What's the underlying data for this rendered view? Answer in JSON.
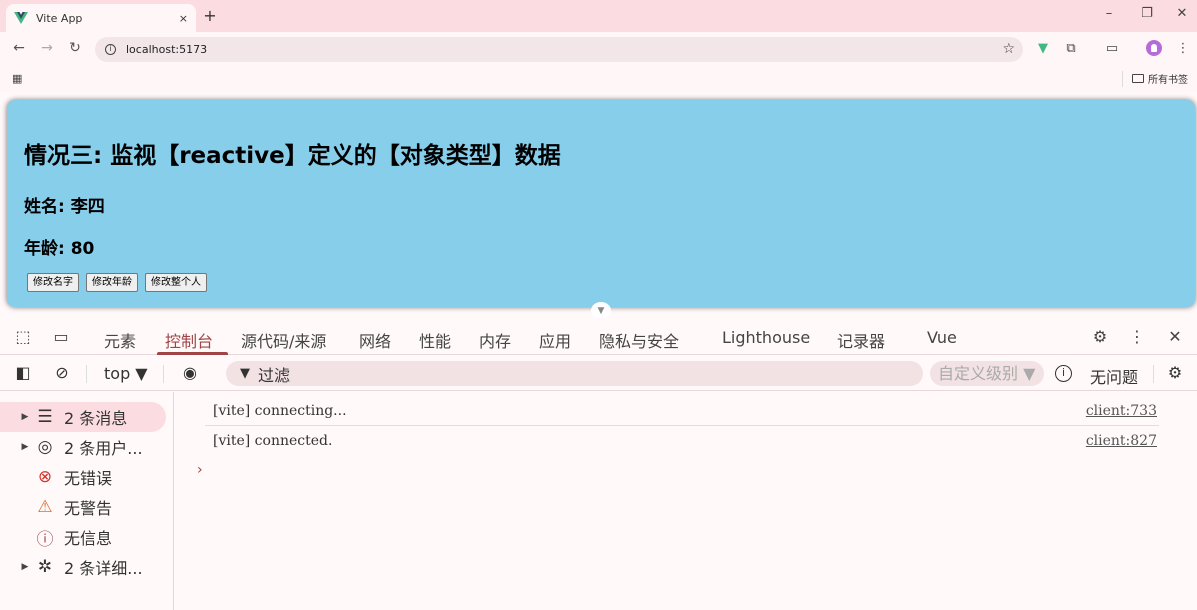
{
  "browser": {
    "tab_title": "Vite App",
    "tab_close": "×",
    "new_tab": "+",
    "address": "localhost:5173",
    "bookmarks_folder": "所有书签"
  },
  "page": {
    "heading": "情况三: 监视【reactive】定义的【对象类型】数据",
    "name_line": "姓名: 李四",
    "age_line": "年龄: 80",
    "buttons": [
      "修改名字",
      "修改年龄",
      "修改整个人"
    ]
  },
  "devtools": {
    "tabs": [
      "元素",
      "控制台",
      "源代码/来源",
      "网络",
      "性能",
      "内存",
      "应用",
      "隐私与安全",
      "Lighthouse",
      "记录器",
      "Vue"
    ],
    "active_tab": "控制台",
    "context": "top ▼",
    "filter_placeholder": "过滤",
    "levels": "自定义级别 ▼",
    "issues": "无问题",
    "sidebar": [
      {
        "label": "2 条消息",
        "icon": "list-icon"
      },
      {
        "label": "2 条用户...",
        "icon": "user-icon"
      },
      {
        "label": "无错误",
        "icon": "error-icon"
      },
      {
        "label": "无警告",
        "icon": "warning-icon"
      },
      {
        "label": "无信息",
        "icon": "info-icon"
      },
      {
        "label": "2 条详细...",
        "icon": "bug-icon"
      }
    ],
    "logs": [
      {
        "text": "[vite] connecting...",
        "source": "client:733"
      },
      {
        "text": "[vite] connected.",
        "source": "client:827"
      }
    ]
  },
  "colors": {
    "card_bg": "#87ceeb",
    "accent": "#9f4545"
  }
}
